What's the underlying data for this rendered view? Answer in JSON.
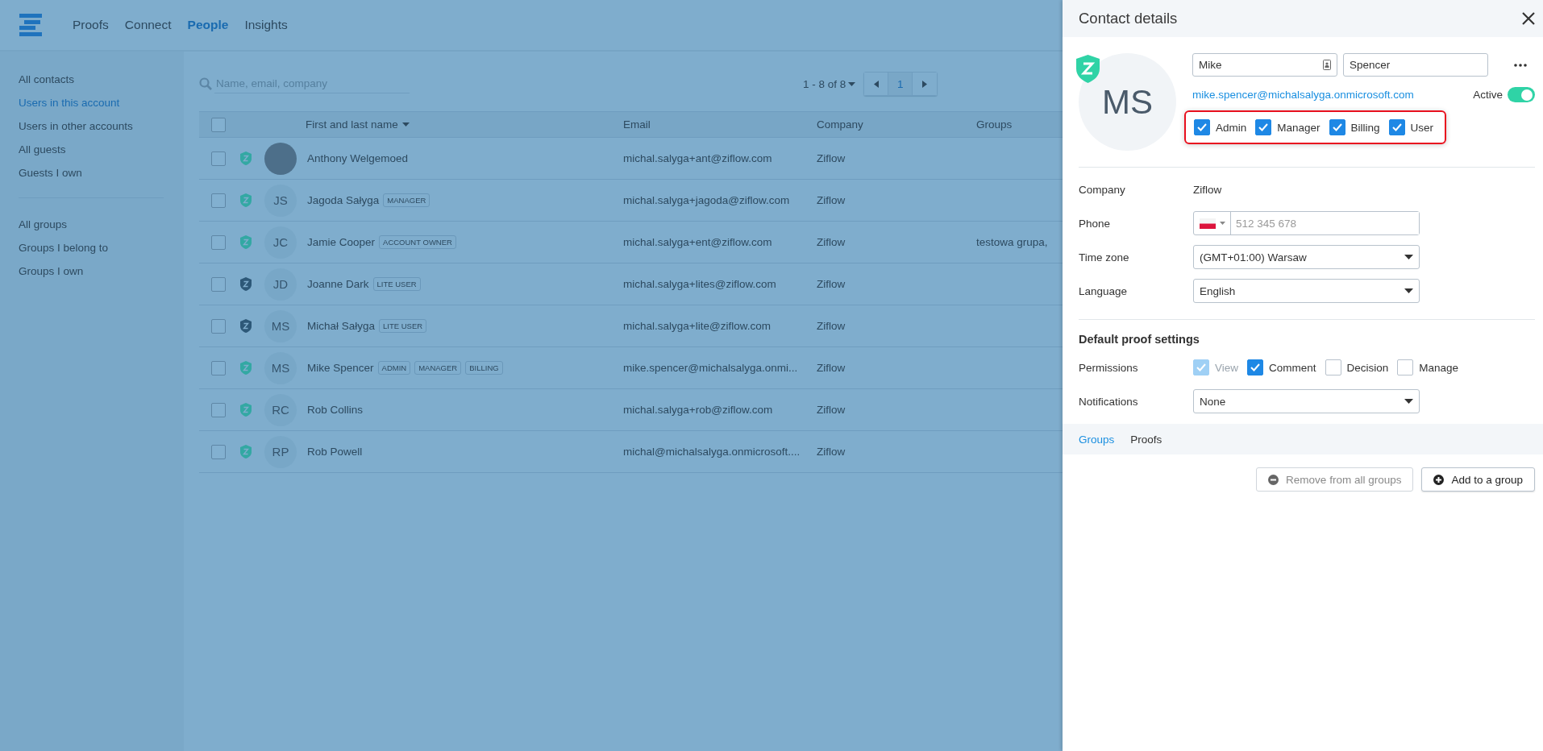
{
  "nav": {
    "items": [
      {
        "label": "Proofs",
        "selected": false
      },
      {
        "label": "Connect",
        "selected": false
      },
      {
        "label": "People",
        "selected": true
      },
      {
        "label": "Insights",
        "selected": false
      }
    ]
  },
  "sidebar": {
    "contact_filters": [
      {
        "label": "All contacts",
        "selected": false
      },
      {
        "label": "Users in this account",
        "selected": true
      },
      {
        "label": "Users in other accounts",
        "selected": false
      },
      {
        "label": "All guests",
        "selected": false
      },
      {
        "label": "Guests I own",
        "selected": false
      }
    ],
    "group_filters": [
      {
        "label": "All groups",
        "selected": false
      },
      {
        "label": "Groups I belong to",
        "selected": false
      },
      {
        "label": "Groups I own",
        "selected": false
      }
    ]
  },
  "search": {
    "placeholder": "Name, email, company"
  },
  "pagination": {
    "range": "1 - 8 of 8",
    "pages": [
      {
        "label": "1",
        "selected": true
      }
    ]
  },
  "table": {
    "header_checked": false,
    "columns": [
      {
        "label": "First and last name",
        "sorted": true
      },
      {
        "label": "Email",
        "sorted": false
      },
      {
        "label": "Company",
        "sorted": false
      },
      {
        "label": "Groups",
        "sorted": false
      }
    ],
    "rows": [
      {
        "checked": false,
        "color": "#33a8a3",
        "avatar": {
          "kind": "photo"
        },
        "name": "Anthony Welgemoed",
        "badges": [],
        "email": "michal.salyga+ant@ziflow.com",
        "company": "Ziflow"
      },
      {
        "checked": false,
        "color": "#33a8a3",
        "avatar": {
          "kind": "initials",
          "text": "JS"
        },
        "name": "Jagoda Sałyga",
        "badges": [
          "MANAGER"
        ],
        "email": "michal.salyga+jagoda@ziflow.com",
        "company": "Ziflow"
      },
      {
        "checked": false,
        "color": "#33a8a3",
        "avatar": {
          "kind": "initials",
          "text": "JC"
        },
        "name": "Jamie Cooper",
        "badges": [
          "ACCOUNT OWNER"
        ],
        "email": "michal.salyga+ent@ziflow.com",
        "company": "Ziflow",
        "groups": "testowa grupa,"
      },
      {
        "checked": false,
        "color": "#2d5878",
        "avatar": {
          "kind": "initials",
          "text": "JD"
        },
        "name": "Joanne Dark",
        "badges": [
          "LITE USER"
        ],
        "email": "michal.salyga+lites@ziflow.com",
        "company": "Ziflow"
      },
      {
        "checked": false,
        "color": "#2d5878",
        "avatar": {
          "kind": "initials",
          "text": "MS"
        },
        "name": "Michał Sałyga",
        "badges": [
          "LITE USER"
        ],
        "email": "michal.salyga+lite@ziflow.com",
        "company": "Ziflow"
      },
      {
        "checked": false,
        "color": "#33a8a3",
        "avatar": {
          "kind": "initials",
          "text": "MS"
        },
        "name": "Mike Spencer",
        "badges": [
          "ADMIN",
          "MANAGER",
          "BILLING"
        ],
        "email": "mike.spencer@michalsalyga.onmi...",
        "company": "Ziflow"
      },
      {
        "checked": false,
        "color": "#33a8a3",
        "avatar": {
          "kind": "initials",
          "text": "RC"
        },
        "name": "Rob Collins",
        "badges": [],
        "email": "michal.salyga+rob@ziflow.com",
        "company": "Ziflow"
      },
      {
        "checked": false,
        "color": "#33a8a3",
        "avatar": {
          "kind": "initials",
          "text": "RP"
        },
        "name": "Rob Powell",
        "badges": [],
        "email": "michal@michalsalyga.onmicrosoft....",
        "company": "Ziflow"
      }
    ]
  },
  "panel": {
    "title": "Contact details",
    "initials": "MS",
    "first_name": "Mike",
    "last_name": "Spencer",
    "email": "mike.spencer@michalsalyga.onmicrosoft.com",
    "active": {
      "label": "Active",
      "on": true
    },
    "roles": {
      "highlighted": true,
      "items": [
        {
          "label": "Admin",
          "checked": true
        },
        {
          "label": "Manager",
          "checked": true
        },
        {
          "label": "Billing",
          "checked": true
        },
        {
          "label": "User",
          "checked": true
        }
      ]
    },
    "details": [
      {
        "label": "Company",
        "kind": "text",
        "value": "Ziflow"
      },
      {
        "label": "Phone",
        "kind": "phone",
        "placeholder": "512 345 678"
      },
      {
        "label": "Time zone",
        "kind": "select",
        "value": "(GMT+01:00) Warsaw"
      },
      {
        "label": "Language",
        "kind": "select",
        "value": "English"
      }
    ],
    "proof_settings": {
      "title": "Default proof settings",
      "rows": [
        {
          "label": "Permissions",
          "kind": "checks",
          "options": [
            {
              "label": "View",
              "checked": true,
              "disabled": true
            },
            {
              "label": "Comment",
              "checked": true,
              "disabled": false
            },
            {
              "label": "Decision",
              "checked": false,
              "disabled": false
            },
            {
              "label": "Manage",
              "checked": false,
              "disabled": false
            }
          ]
        },
        {
          "label": "Notifications",
          "kind": "select",
          "value": "None"
        }
      ]
    },
    "tabs": [
      {
        "label": "Groups",
        "selected": true
      },
      {
        "label": "Proofs",
        "selected": false
      }
    ],
    "buttons": [
      {
        "label": "Remove from all groups",
        "kind": "remove",
        "disabled": true
      },
      {
        "label": "Add to a group",
        "kind": "add",
        "disabled": false
      }
    ]
  }
}
